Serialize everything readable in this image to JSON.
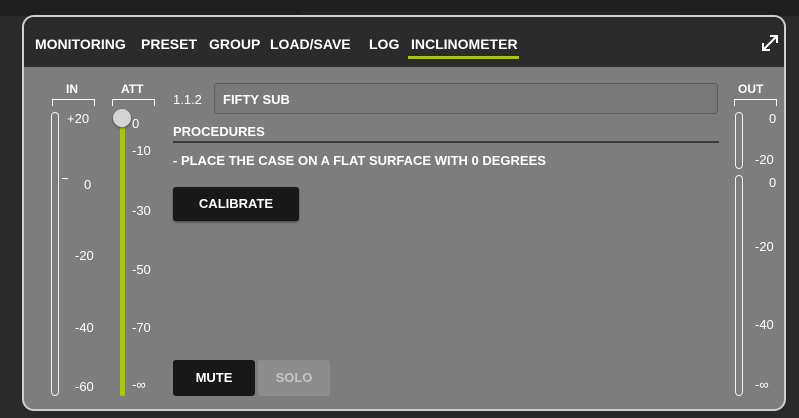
{
  "tabs": [
    {
      "label": "MONITORING"
    },
    {
      "label": "PRESET"
    },
    {
      "label": "GROUP"
    },
    {
      "label": "LOAD/SAVE"
    },
    {
      "label": "LOG"
    },
    {
      "label": "INCLINOMETER",
      "active": true
    }
  ],
  "icons": {
    "expand": "expand-icon"
  },
  "in_meter": {
    "label": "IN",
    "scale": [
      "+20",
      "0",
      "-20",
      "-40",
      "-60"
    ]
  },
  "att_fader": {
    "label": "ATT",
    "scale": [
      "0",
      "-10",
      "-30",
      "-50",
      "-70",
      "-∞"
    ],
    "value": "0"
  },
  "out_meter": {
    "label": "OUT",
    "upper_scale": [
      "0",
      "-20"
    ],
    "lower_scale": [
      "0",
      "-20",
      "-40",
      "-∞"
    ]
  },
  "channel": {
    "id": "1.1.2",
    "name": "FIFTY SUB"
  },
  "procedures": {
    "title": "PROCEDURES",
    "instruction": "- PLACE THE CASE ON A FLAT SURFACE WITH 0 DEGREES"
  },
  "buttons": {
    "calibrate": "CALIBRATE",
    "mute": "MUTE",
    "solo": "SOLO"
  },
  "colors": {
    "accent": "#a6c619",
    "panel": "#7d7d7d",
    "header": "#2b2b2b"
  }
}
